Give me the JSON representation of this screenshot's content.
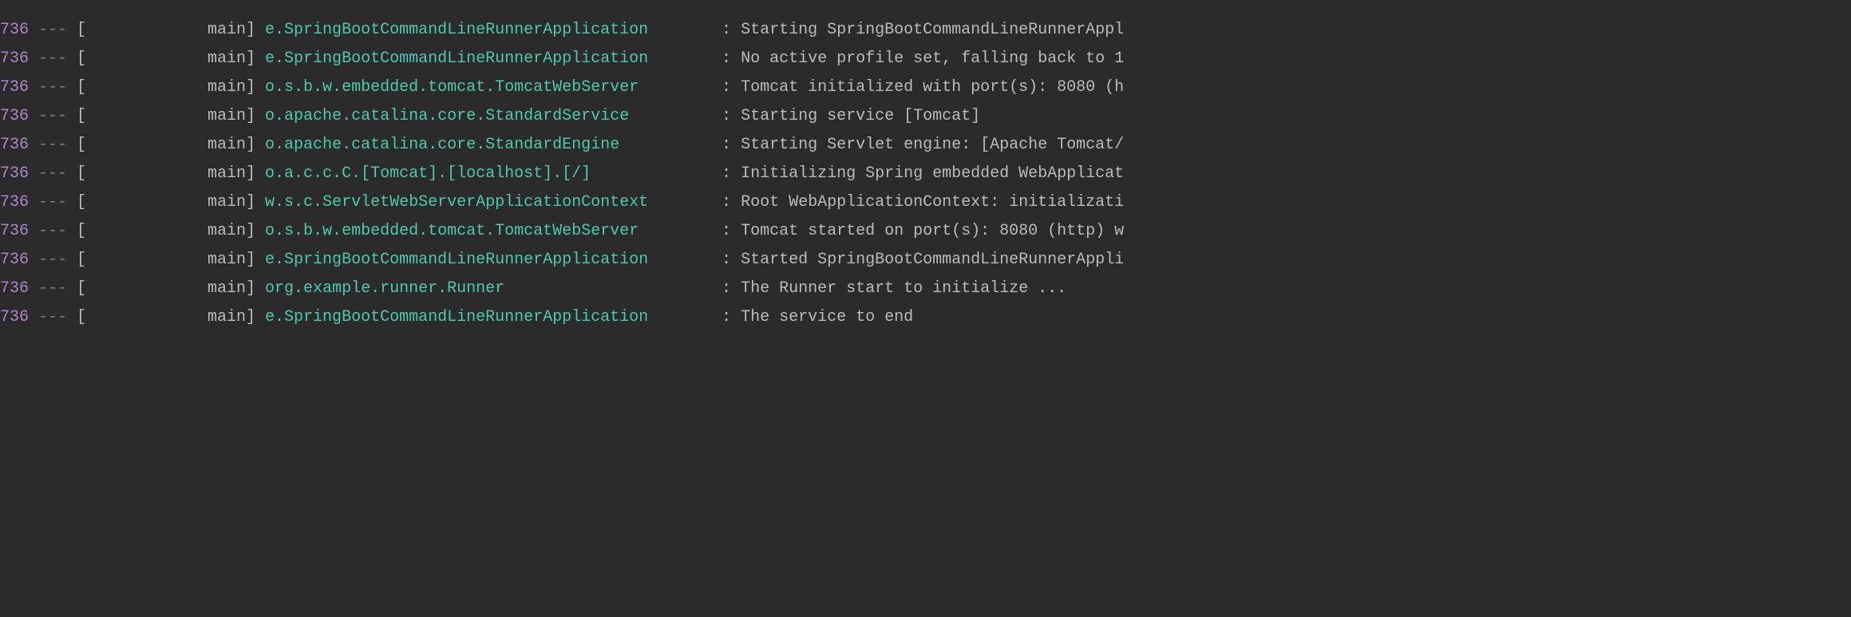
{
  "logs": [
    {
      "pid": "736",
      "dashes": "---",
      "thread": "main",
      "logger": "e.SpringBootCommandLineRunnerApplication",
      "message": "Starting SpringBootCommandLineRunnerAppl"
    },
    {
      "pid": "736",
      "dashes": "---",
      "thread": "main",
      "logger": "e.SpringBootCommandLineRunnerApplication",
      "message": "No active profile set, falling back to 1"
    },
    {
      "pid": "736",
      "dashes": "---",
      "thread": "main",
      "logger": "o.s.b.w.embedded.tomcat.TomcatWebServer",
      "message": "Tomcat initialized with port(s): 8080 (h"
    },
    {
      "pid": "736",
      "dashes": "---",
      "thread": "main",
      "logger": "o.apache.catalina.core.StandardService",
      "message": "Starting service [Tomcat]"
    },
    {
      "pid": "736",
      "dashes": "---",
      "thread": "main",
      "logger": "o.apache.catalina.core.StandardEngine",
      "message": "Starting Servlet engine: [Apache Tomcat/"
    },
    {
      "pid": "736",
      "dashes": "---",
      "thread": "main",
      "logger": "o.a.c.c.C.[Tomcat].[localhost].[/]",
      "message": "Initializing Spring embedded WebApplicat"
    },
    {
      "pid": "736",
      "dashes": "---",
      "thread": "main",
      "logger": "w.s.c.ServletWebServerApplicationContext",
      "message": "Root WebApplicationContext: initializati"
    },
    {
      "pid": "736",
      "dashes": "---",
      "thread": "main",
      "logger": "o.s.b.w.embedded.tomcat.TomcatWebServer",
      "message": "Tomcat started on port(s): 8080 (http) w"
    },
    {
      "pid": "736",
      "dashes": "---",
      "thread": "main",
      "logger": "e.SpringBootCommandLineRunnerApplication",
      "message": "Started SpringBootCommandLineRunnerAppli"
    },
    {
      "pid": "736",
      "dashes": "---",
      "thread": "main",
      "logger": "org.example.runner.Runner",
      "message": "The Runner start to initialize ..."
    },
    {
      "pid": "736",
      "dashes": "---",
      "thread": "main",
      "logger": "e.SpringBootCommandLineRunnerApplication",
      "message": "The service to end"
    }
  ]
}
